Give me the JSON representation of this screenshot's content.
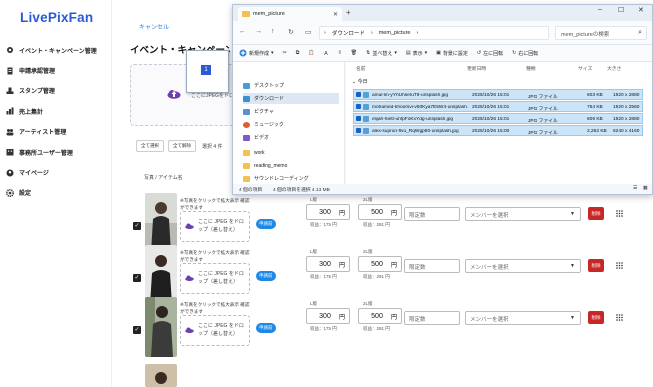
{
  "app": {
    "logo": "LivePixFan",
    "sidebar": [
      {
        "label": "イベント・キャンペーン管理",
        "icon": "gear-badge-icon"
      },
      {
        "label": "申請承認管理",
        "icon": "document-icon"
      },
      {
        "label": "スタンプ管理",
        "icon": "stamp-icon"
      },
      {
        "label": "売上集計",
        "icon": "bar-chart-icon"
      },
      {
        "label": "アーティスト管理",
        "icon": "people-icon"
      },
      {
        "label": "事務所ユーザー管理",
        "icon": "office-users-icon"
      },
      {
        "label": "マイページ",
        "icon": "user-icon"
      },
      {
        "label": "設定",
        "icon": "gear-icon"
      }
    ],
    "cancel_label": "キャンセル",
    "page_title": "イベント・キャンペーン登録",
    "dropzone_text": "ここにJPEGをドロップ",
    "drag_ghost_badge": "1",
    "toolbar": {
      "select_all": "全て選択",
      "deselect_all": "全て解除",
      "selected_count": "選択 4 件"
    },
    "column_header": "写真 / アイテム名",
    "rows": [
      {
        "hint": "※写真をクリックで拡大表示 確認ができます",
        "drop_text": "ここに JPEG をドロップ（差し替え）",
        "badge": "申請前",
        "l_label": "L版",
        "l_price": "300",
        "l_unit": "円",
        "l_revenue": "収益：175 円",
        "ll_label": "2L版",
        "ll_price": "500",
        "ll_unit": "円",
        "ll_revenue": "収益：291 円",
        "limit_placeholder": "限定数",
        "member_placeholder": "メンバーを選択",
        "delete_label": "削除",
        "checked": true
      },
      {
        "hint": "※写真をクリックで拡大表示 確認ができます",
        "drop_text": "ここに JPEG をドロップ（差し替え）",
        "badge": "申請前",
        "l_label": "L版",
        "l_price": "300",
        "l_unit": "円",
        "l_revenue": "収益：175 円",
        "ll_label": "2L版",
        "ll_price": "500",
        "ll_unit": "円",
        "ll_revenue": "収益：291 円",
        "limit_placeholder": "限定数",
        "member_placeholder": "メンバーを選択",
        "delete_label": "削除",
        "checked": true
      },
      {
        "hint": "※写真をクリックで拡大表示 確認ができます",
        "drop_text": "ここに JPEG をドロップ（差し替え）",
        "badge": "申請前",
        "l_label": "L版",
        "l_price": "300",
        "l_unit": "円",
        "l_revenue": "収益：175 円",
        "ll_label": "2L版",
        "ll_price": "500",
        "ll_unit": "円",
        "ll_revenue": "収益：291 円",
        "limit_placeholder": "限定数",
        "member_placeholder": "メンバーを選択",
        "delete_label": "削除",
        "checked": true
      }
    ],
    "colors": {
      "brand": "#2a5bd7",
      "badge": "#1e88e5",
      "delete": "#c62828"
    }
  },
  "explorer": {
    "tab_title": "mem_picture",
    "window_controls": [
      "–",
      "☐",
      "✕"
    ],
    "breadcrumbs": [
      "ダウンロード",
      "mem_picture"
    ],
    "search_placeholder": "mem_pictureの検索",
    "commands": [
      "新規作成",
      "並べ替え",
      "表示",
      "背景に設定",
      "左に回転",
      "右に回転"
    ],
    "nav_items": [
      {
        "label": "デスクトップ",
        "color": "#4a9ad8"
      },
      {
        "label": "ダウンロード",
        "color": "#3c8fd6",
        "selected": true
      },
      {
        "label": "ピクチャ",
        "color": "#5a8fd0"
      },
      {
        "label": "ミュージック",
        "color": "#e05a3a"
      },
      {
        "label": "ビデオ",
        "color": "#7b5cc9"
      },
      {
        "label": "work",
        "color": "#f2c14e"
      },
      {
        "label": "reading_memo",
        "color": "#f2c14e"
      },
      {
        "label": "サウンドレコーディング",
        "color": "#f2c14e"
      }
    ],
    "columns": [
      "名前",
      "更新日時",
      "種類",
      "サイズ",
      "大きさ"
    ],
    "group_label": "今日",
    "files": [
      {
        "name": "amul-lin-yYhUhseIuT8-unsplash.jpg",
        "date": "2025/10/26 15:01",
        "type": "JPG ファイル",
        "size": "603 KB",
        "dims": "1920 x 2880"
      },
      {
        "name": "mohamed-khoorsvi-v50Kya7E5W4-unsplash.jpg",
        "date": "2025/10/26 15:01",
        "type": "JPG ファイル",
        "size": "764 KB",
        "dims": "1920 x 2560"
      },
      {
        "name": "elijah-hiett-unfpFoKxYdg-unsplash.jpg",
        "date": "2025/10/26 15:01",
        "type": "JPG ファイル",
        "size": "609 KB",
        "dims": "1920 x 2880"
      },
      {
        "name": "alex-suprun-flvu_RqWgp80-unsplash.jpg",
        "date": "2025/10/26 15:00",
        "type": "JPG ファイル",
        "size": "2,262 KB",
        "dims": "6240 x 4160"
      }
    ],
    "status_count": "4 個の項目",
    "status_selected": "4 個の項目を選択  4.13 MB"
  }
}
